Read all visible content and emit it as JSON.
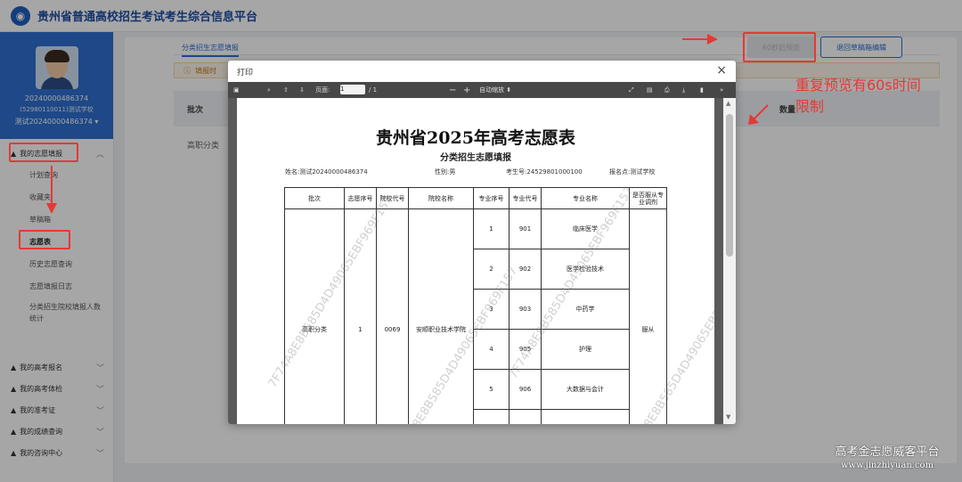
{
  "header": {
    "title": "贵州省普通高校招生考试考生综合信息平台"
  },
  "profile": {
    "id": "20240000486374",
    "school": "(52980110011)测试学校",
    "user": "测试20240000486374"
  },
  "sidebar": {
    "main_group": "我的志愿填报",
    "items": [
      "计划查询",
      "收藏夹",
      "草稿箱",
      "志愿表",
      "历史志愿查询",
      "志愿填报日志",
      "分类招生院校填报人数统计"
    ],
    "groups": [
      "我的高考报名",
      "我的高考体检",
      "我的准考证",
      "我的成绩查询",
      "我的咨询中心"
    ]
  },
  "main": {
    "tab": "分类招生志愿填报",
    "notice": "填报时",
    "table_head_batch": "批次",
    "table_head_count": "数量",
    "row_batch": "高职分类",
    "btn_preview": "60秒后预览",
    "btn_back": "退回草稿箱编辑"
  },
  "annotation": {
    "line1": "重复预览有60s时间",
    "line2": "限制"
  },
  "footer_watermark": {
    "name": "高考金志愿威客平台",
    "url": "www.jinzhiyuan.com"
  },
  "dialog": {
    "title": "打印",
    "toolbar": {
      "page_label": "页面:",
      "page_num": "1",
      "page_total": "/ 1",
      "zoom": "自动缩放"
    },
    "doc": {
      "title": "贵州省2025年高考志愿表",
      "subtitle": "分类招生志愿填报",
      "name": "姓名:测试20240000486374",
      "gender": "性别:男",
      "exam_no": "考生号:24529801000100",
      "site": "报名点:测试学校",
      "headers": [
        "批次",
        "志愿序号",
        "院校代号",
        "院校名称",
        "专业序号",
        "专业代号",
        "专业名称",
        "是否服从专业调剂"
      ],
      "batch": "高职分类",
      "vol_no": "1",
      "school_code": "0069",
      "school_name": "安顺职业技术学院",
      "adjust": "服从",
      "majors": [
        {
          "seq": "1",
          "code": "901",
          "name": "临床医学"
        },
        {
          "seq": "2",
          "code": "902",
          "name": "医学检验技术"
        },
        {
          "seq": "3",
          "code": "903",
          "name": "中药学"
        },
        {
          "seq": "4",
          "code": "905",
          "name": "护理"
        },
        {
          "seq": "5",
          "code": "906",
          "name": "大数据与会计"
        }
      ],
      "watermark": "7F74A8E8B585D4D49065EBF969F157"
    }
  },
  "colors": {
    "accent": "#2e6fd0",
    "highlight": "#e53935"
  }
}
